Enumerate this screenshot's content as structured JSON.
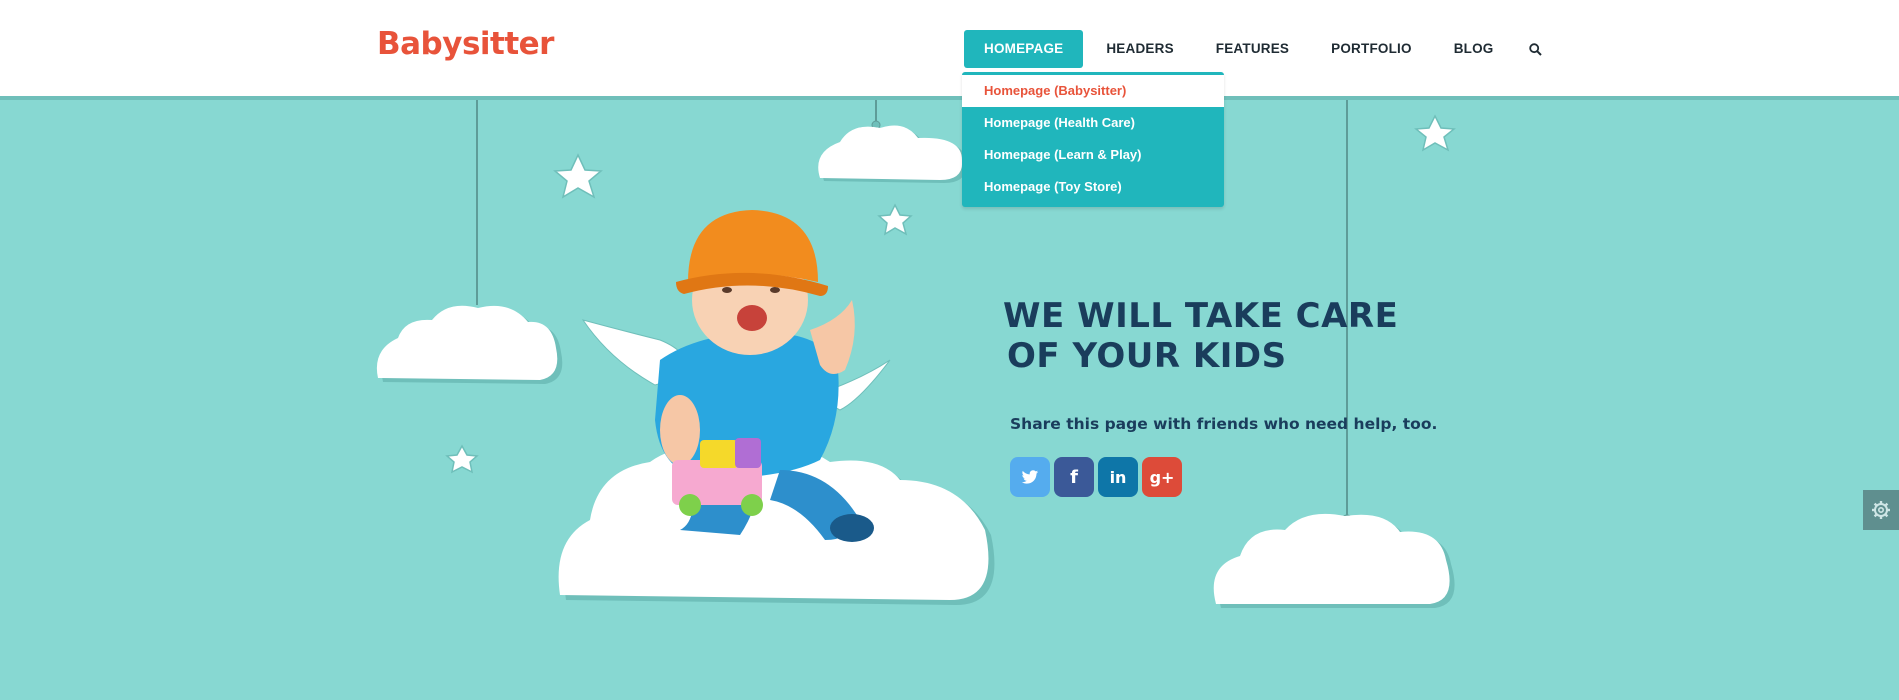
{
  "header": {
    "logo": "Babysitter",
    "nav": [
      {
        "label": "HOMEPAGE",
        "active": true
      },
      {
        "label": "HEADERS"
      },
      {
        "label": "FEATURES"
      },
      {
        "label": "PORTFOLIO"
      },
      {
        "label": "BLOG"
      }
    ],
    "search_icon": "search-icon"
  },
  "dropdown": {
    "items": [
      {
        "label": "Homepage (Babysitter)",
        "current": true
      },
      {
        "label": "Homepage (Health Care)"
      },
      {
        "label": "Homepage (Learn & Play)"
      },
      {
        "label": "Homepage (Toy Store)"
      }
    ]
  },
  "hero": {
    "title_line1": "WE WILL TAKE CARE",
    "title_line2": "OF YOUR KIDS",
    "share_text": "Share this page with friends who need help, too."
  },
  "social": {
    "twitter": "twitter-icon",
    "facebook": "f",
    "linkedin": "in",
    "googleplus": "g+"
  },
  "colors": {
    "background": "#87d8d2",
    "accent": "#20b6bc",
    "logo": "#e8533a",
    "title": "#1a3d5c"
  }
}
